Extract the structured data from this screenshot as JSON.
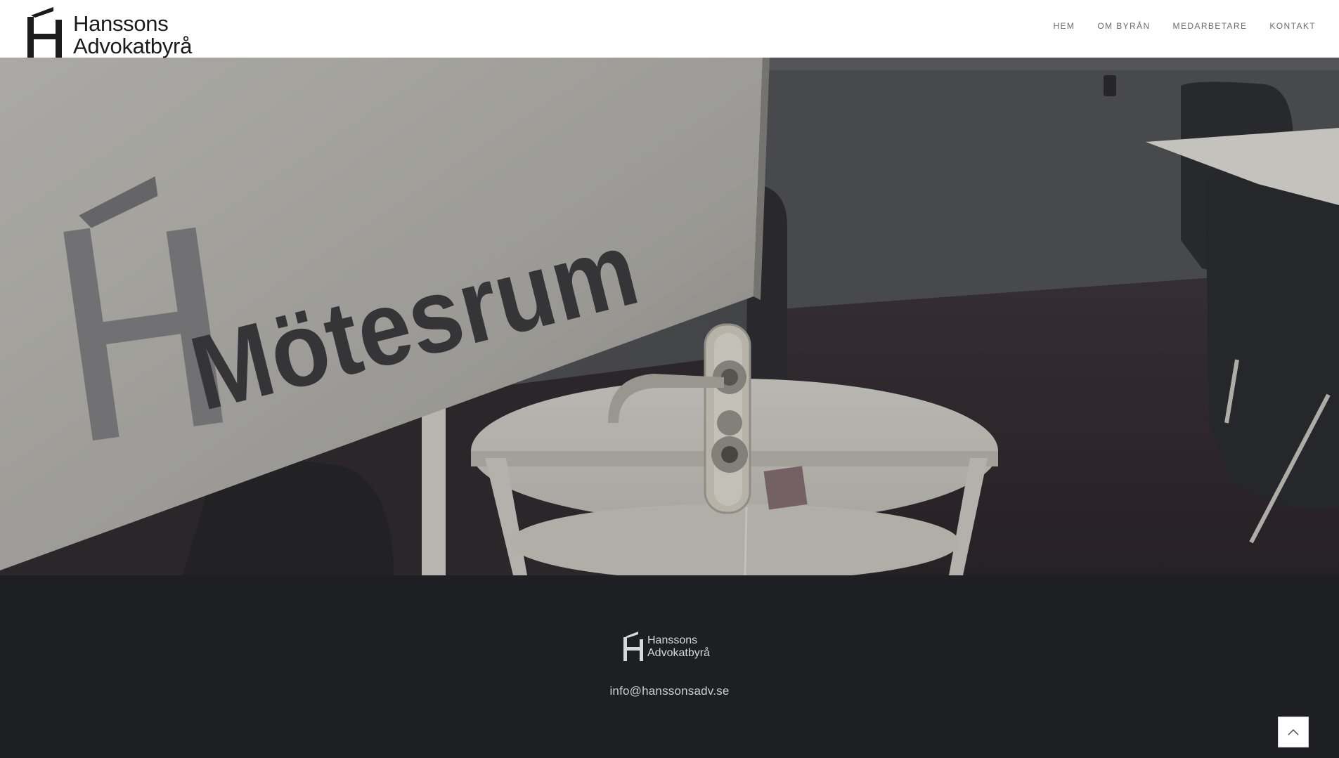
{
  "brand": {
    "line1": "Hanssons",
    "line2": "Advokatbyrå"
  },
  "nav": {
    "items": [
      {
        "label": "HEM"
      },
      {
        "label": "OM BYRÅN"
      },
      {
        "label": "MEDARBETARE"
      },
      {
        "label": "KONTAKT"
      }
    ]
  },
  "hero": {
    "sign_text": "Mötesrum"
  },
  "footer": {
    "email": "info@hanssonsadv.se"
  },
  "icons": {
    "logo": "h-mark-icon",
    "back_to_top": "chevron-up-icon"
  },
  "colors": {
    "header_bg": "#ffffff",
    "footer_bg": "#1e1f22",
    "nav_text": "#6b6b6b"
  }
}
